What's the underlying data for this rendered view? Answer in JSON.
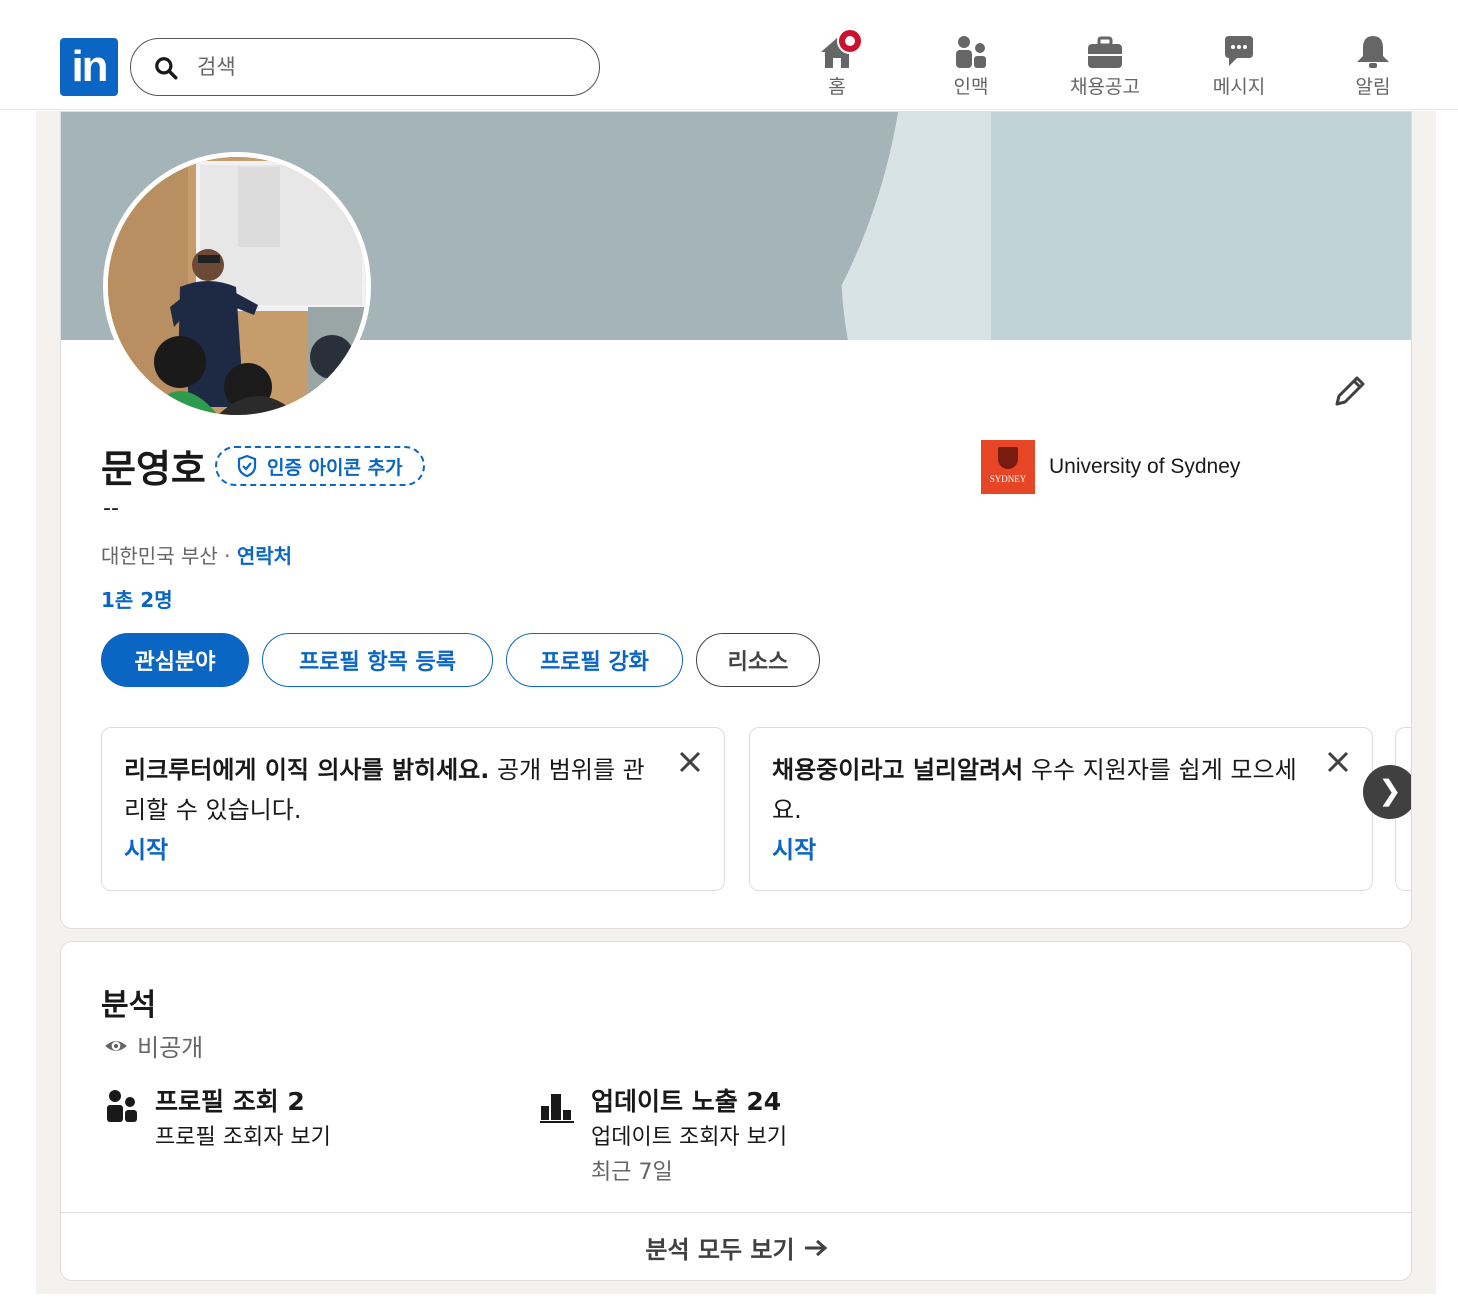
{
  "nav": {
    "logo_text": "in",
    "search_placeholder": "검색",
    "items": [
      {
        "label": "홈",
        "icon": "home-icon"
      },
      {
        "label": "인맥",
        "icon": "network-icon"
      },
      {
        "label": "채용공고",
        "icon": "briefcase-icon"
      },
      {
        "label": "메시지",
        "icon": "messaging-icon"
      },
      {
        "label": "알림",
        "icon": "bell-icon"
      }
    ],
    "brand_color": "#0a66c2",
    "badge_color": "#cb112d"
  },
  "profile": {
    "name": "문영호",
    "verify_label": "인증 아이콘 추가",
    "headline": "--",
    "location": "대한민국 부산 · ",
    "contact_label": "연락처",
    "connections": "1촌 2명",
    "education": "University of Sydney",
    "education_logo_text": "SYDNEY",
    "buttons": [
      "관심분야",
      "프로필 항목 등록",
      "프로필 강화",
      "리소스"
    ]
  },
  "notices": [
    {
      "bold": "리크루터에게 이직 의사를 밝히세요.",
      "text": " 공개 범위를 관리할 수 있습니다.",
      "action": "시작"
    },
    {
      "bold": "채용중이라고 널리알려서",
      "text": " 우수 지원자를 쉽게 모으세요.",
      "action": "시작"
    }
  ],
  "analytics": {
    "title": "분석",
    "visibility": "비공개",
    "items": [
      {
        "title": "프로필 조회 2",
        "subtitle": "프로필 조회자 보기",
        "note": ""
      },
      {
        "title": "업데이트 노출 24",
        "subtitle": "업데이트 조회자 보기",
        "note": "최근 7일"
      }
    ],
    "footer": "분석 모두 보기"
  }
}
